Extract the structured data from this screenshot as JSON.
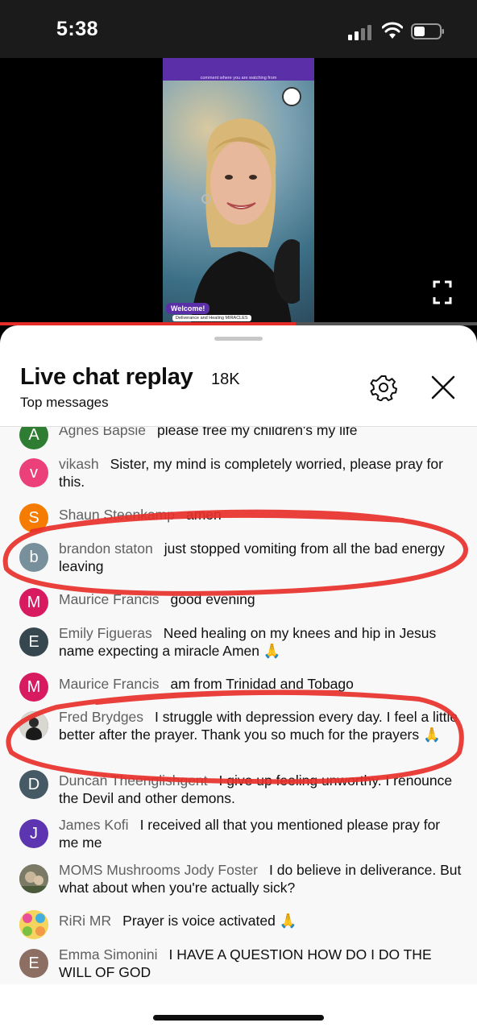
{
  "status_bar": {
    "time": "5:38"
  },
  "video": {
    "top_banner": "comment where you are watching from",
    "welcome_badge": "Welcome!",
    "ticker": "Deliverance and Healing MIRACLES",
    "progress_fraction": 0.62
  },
  "chat": {
    "title": "Live chat replay",
    "count": "18K",
    "filter": "Top messages",
    "messages": [
      {
        "author": "Agnes Bapsie",
        "text": "please free my children's my life",
        "initial": "A",
        "color": "#2e7d32"
      },
      {
        "author": "vikash",
        "text": "Sister, my mind is completely worried, please pray for this.",
        "initial": "v",
        "color": "#ec407a"
      },
      {
        "author": "Shaun Steenkamp",
        "text": "amen",
        "initial": "S",
        "color": "#f57c00"
      },
      {
        "author": "brandon staton",
        "text": "just stopped vomiting from all the bad energy leaving",
        "initial": "b",
        "color": "#78909c"
      },
      {
        "author": "Maurice Francis",
        "text": "good evening",
        "initial": "M",
        "color": "#d81b60"
      },
      {
        "author": "Emily Figueras",
        "text": "Need healing on my knees and hip in Jesus name expecting a miracle Amen 🙏",
        "initial": "E",
        "color": "#37474f"
      },
      {
        "author": "Maurice Francis",
        "text": "am from Trinidad and Tobago",
        "initial": "M",
        "color": "#d81b60"
      },
      {
        "author": "Fred Brydges",
        "text": "I struggle with depression every day. I feel a little better after the prayer. Thank you so much for the prayers 🙏",
        "initial": "",
        "color": "#2b2b2b"
      },
      {
        "author": "Duncan Theenglishgent",
        "text": "I give up feeling unworthy. I renounce the Devil and other demons.",
        "initial": "D",
        "color": "#455a64"
      },
      {
        "author": "James Kofi",
        "text": "I received all that you mentioned please pray for me me",
        "initial": "J",
        "color": "#5e35b1"
      },
      {
        "author": "MOMS Mushrooms Jody Foster",
        "text": "I do believe in deliverance. But what about when you're actually sick?",
        "initial": "",
        "color": "#6d6d5a"
      },
      {
        "author": "RiRi MR",
        "text": "Prayer is voice activated 🙏",
        "initial": "",
        "color": "#f2c94c"
      },
      {
        "author": "Emma Simonini",
        "text": "I HAVE A QUESTION HOW DO I DO THE WILL OF GOD",
        "initial": "E",
        "color": "#8d6e63"
      }
    ]
  },
  "icons": {
    "signal": "signal-bars-icon",
    "wifi": "wifi-icon",
    "battery": "battery-icon",
    "fullscreen": "fullscreen-icon",
    "settings": "gear-icon",
    "close": "close-icon"
  }
}
